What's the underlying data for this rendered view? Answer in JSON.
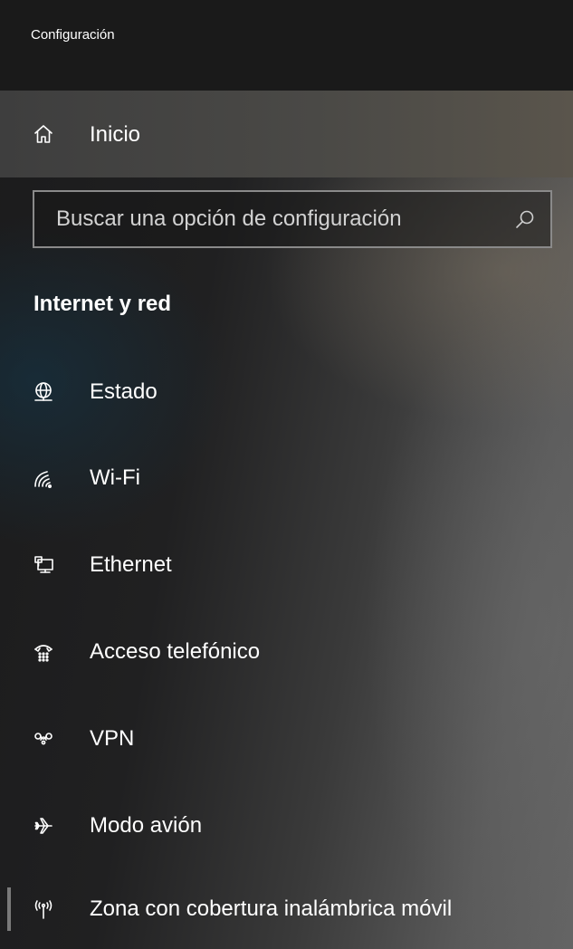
{
  "window": {
    "title": "Configuración"
  },
  "home": {
    "label": "Inicio",
    "icon": "home-icon"
  },
  "search": {
    "placeholder": "Buscar una opción de configuración",
    "icon": "search-icon"
  },
  "section": {
    "title": "Internet y red"
  },
  "nav": {
    "items": [
      {
        "label": "Estado",
        "icon": "globe-icon"
      },
      {
        "label": "Wi-Fi",
        "icon": "wifi-icon"
      },
      {
        "label": "Ethernet",
        "icon": "ethernet-icon"
      },
      {
        "label": "Acceso telefónico",
        "icon": "dialup-icon"
      },
      {
        "label": "VPN",
        "icon": "vpn-icon"
      },
      {
        "label": "Modo avión",
        "icon": "airplane-icon"
      },
      {
        "label": "Zona con cobertura inalámbrica móvil",
        "icon": "mobile-hotspot-icon",
        "selected": true
      }
    ]
  },
  "colors": {
    "text": "#ffffff",
    "titlebar": "#1a1a1a",
    "search_border": "#8a8a8a",
    "selected_accent": "#7a7a7a"
  }
}
